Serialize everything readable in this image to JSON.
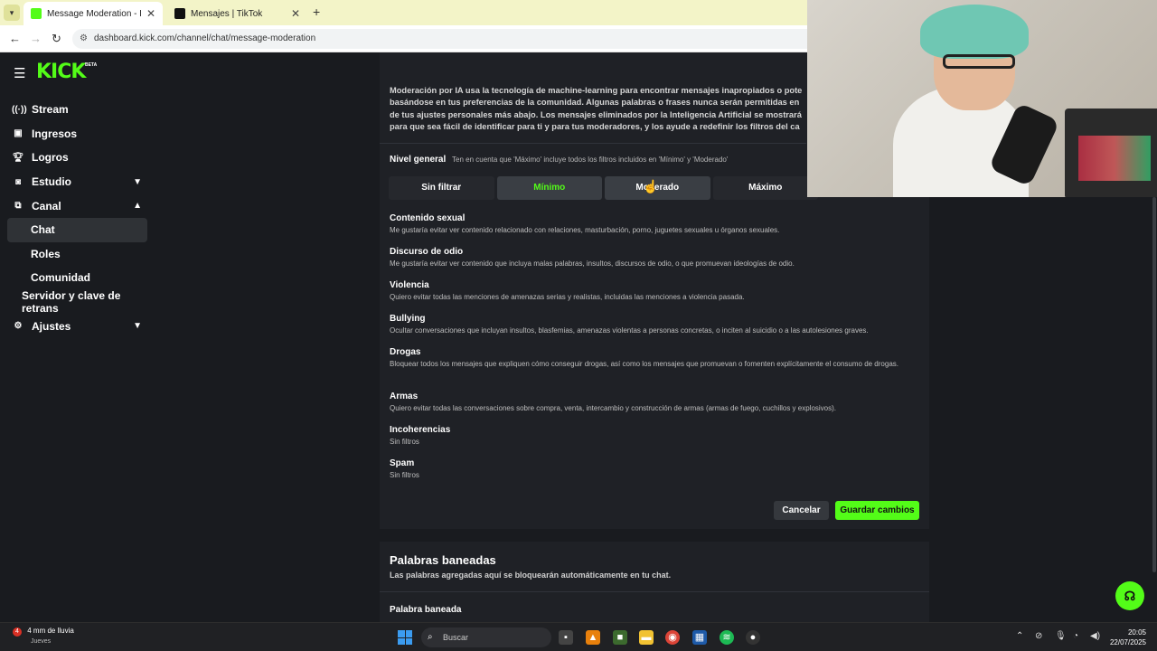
{
  "browser": {
    "tabs": [
      {
        "title": "Message Moderation - Kick Da",
        "active": true
      },
      {
        "title": "Mensajes | TikTok",
        "active": false
      }
    ],
    "url": "dashboard.kick.com/channel/chat/message-moderation"
  },
  "sidebar": {
    "logo": "KICK",
    "beta": "BETA",
    "items": [
      {
        "label": "Stream",
        "icon": "broadcast-icon"
      },
      {
        "label": "Ingresos",
        "icon": "money-icon"
      },
      {
        "label": "Logros",
        "icon": "trophy-icon"
      },
      {
        "label": "Estudio",
        "icon": "studio-icon",
        "chevron": "down"
      },
      {
        "label": "Canal",
        "icon": "channel-icon",
        "chevron": "up"
      },
      {
        "label": "Chat",
        "sub": true,
        "active": true
      },
      {
        "label": "Roles",
        "sub": true
      },
      {
        "label": "Comunidad",
        "sub": true
      },
      {
        "label": "Servidor y clave de retrans",
        "sub": true
      },
      {
        "label": "Ajustes",
        "icon": "gear-icon",
        "chevron": "down"
      }
    ]
  },
  "moderation": {
    "intro_lines": [
      "Moderación por IA usa la tecnología de machine-learning para encontrar mensajes inapropiados o pote",
      "basándose en tus preferencias de la comunidad. Algunas palabras o frases nunca serán permitidas en",
      "de tus ajustes personales más abajo. Los mensajes eliminados por la Inteligencia Artificial se mostrará",
      "para que sea fácil de identificar para ti y para tus moderadores, y los ayude a redefinir los filtros del ca"
    ],
    "level_label": "Nivel general",
    "level_hint": "Ten en cuenta que 'Máximo' incluye todos los filtros incluidos en 'Mínimo' y 'Moderado'",
    "levels": [
      "Sin filtrar",
      "Mínimo",
      "Moderado",
      "Máximo"
    ],
    "selected_level": "Mínimo",
    "categories": [
      {
        "title": "Contenido sexual",
        "desc": "Me gustaría evitar ver contenido relacionado con relaciones, masturbación, porno, juguetes sexuales u órganos sexuales."
      },
      {
        "title": "Discurso de odio",
        "desc": "Me gustaría evitar ver contenido que incluya malas palabras, insultos, discursos de odio, o que promuevan ideologías de odio."
      },
      {
        "title": "Violencia",
        "desc": "Quiero evitar todas las menciones de amenazas serias y realistas, incluidas las menciones a violencia pasada."
      },
      {
        "title": "Bullying",
        "desc": "Ocultar conversaciones que incluyan insultos, blasfemias, amenazas violentas a personas concretas, o inciten al suicidio o a las autolesiones graves."
      },
      {
        "title": "Drogas",
        "desc": "Bloquear todos los mensajes que expliquen cómo conseguir drogas, así como los mensajes que promuevan o fomenten explícitamente el consumo de drogas."
      },
      {
        "title": "Armas",
        "desc": "Quiero evitar todas las conversaciones sobre compra, venta, intercambio y construcción de armas (armas de fuego, cuchillos y explosivos)."
      },
      {
        "title": "Incoherencias",
        "desc": "Sin filtros"
      },
      {
        "title": "Spam",
        "desc": "Sin filtros"
      }
    ],
    "cancel": "Cancelar",
    "save": "Guardar cambios"
  },
  "banned": {
    "title": "Palabras baneadas",
    "subtitle": "Las palabras agregadas aquí se bloquearán automáticamente en tu chat.",
    "field_label": "Palabra baneada"
  },
  "taskbar": {
    "weather_badge": "4",
    "weather": "4 mm de lluvia",
    "weather_sub": "Jueves",
    "search": "Buscar",
    "time": "20:05",
    "date": "22/07/2025"
  },
  "colors": {
    "accent": "#53fc18",
    "bg": "#191b1f",
    "panel": "#1f2126"
  }
}
